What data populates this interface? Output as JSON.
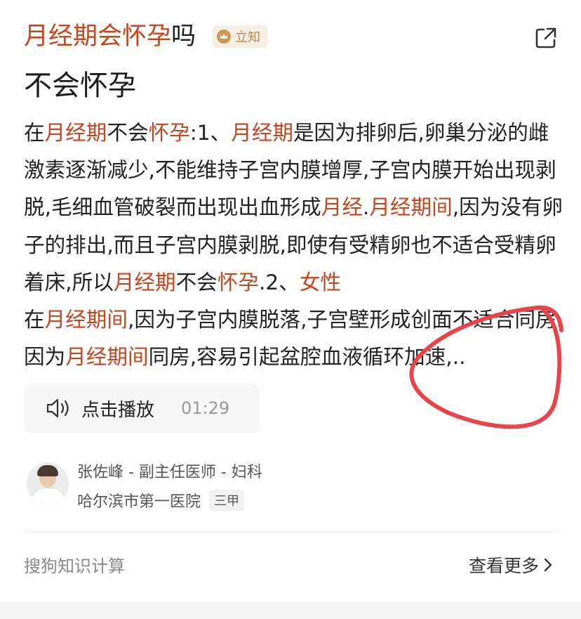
{
  "colors": {
    "highlight": "#c8441d",
    "annotation": "#e8454b"
  },
  "header": {
    "title_hl": "月经期会怀孕",
    "title_rest": "吗",
    "badge": "立知",
    "share_icon": "share-icon"
  },
  "answer": "不会怀孕",
  "body": {
    "s1": "在",
    "s2": "月经期",
    "s3": "不会",
    "s4": "怀孕",
    "s5": ":1、",
    "s6": "月经期",
    "s7": "是因为排卵后,卵巢分泌的雌激素逐渐减少,不能维持子宫内膜增厚,子宫内膜开始出现剥脱,毛细血管破裂而出现出血形成",
    "s8": "月经",
    "s9": ".",
    "s10": "月经期间",
    "s11": ",因为没有卵子的排出,而且子宫内膜剥脱,即使有受精卵也不适合受精卵着床,所以",
    "s12": "月经期",
    "s13": "不会",
    "s14": "怀孕",
    "s15": ".2、",
    "s16": "女性",
    "s17": "在",
    "s18": "月经期间",
    "s19": ",因为子宫内膜脱落,子宫壁形成创面不适合同房.因为",
    "s20": "月经期间",
    "s21": "同房,容易引起盆腔血液循环加速,.."
  },
  "audio": {
    "label": "点击播放",
    "duration": "01:29",
    "icon": "speaker-icon"
  },
  "doctor": {
    "info": "张佐峰 - 副主任医师 - 妇科",
    "hospital": "哈尔滨市第一医院",
    "level": "三甲"
  },
  "footer": {
    "source": "搜狗知识计算",
    "more": "查看更多"
  }
}
